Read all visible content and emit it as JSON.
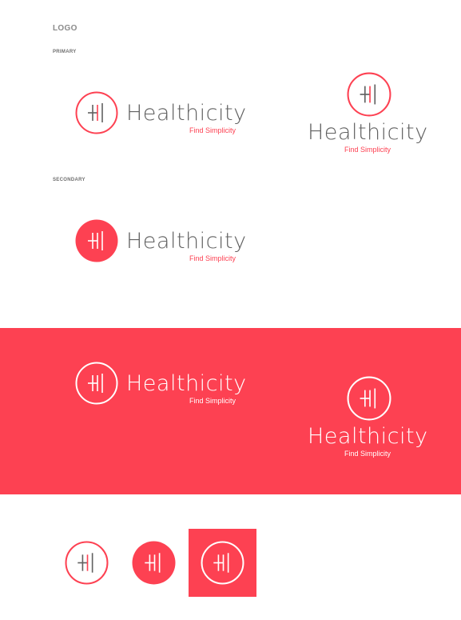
{
  "sections": {
    "logo": "LOGO",
    "primary": "PRIMARY",
    "secondary": "SECONDARY"
  },
  "brand": {
    "name": "Healthicity",
    "tagline": "Find Simplicity",
    "mark_letter": "H"
  },
  "colors": {
    "brand_red": "#fd4152",
    "wordmark_gray": "#616161",
    "white": "#ffffff"
  },
  "icons": [
    "h-circle-mark-icon"
  ]
}
